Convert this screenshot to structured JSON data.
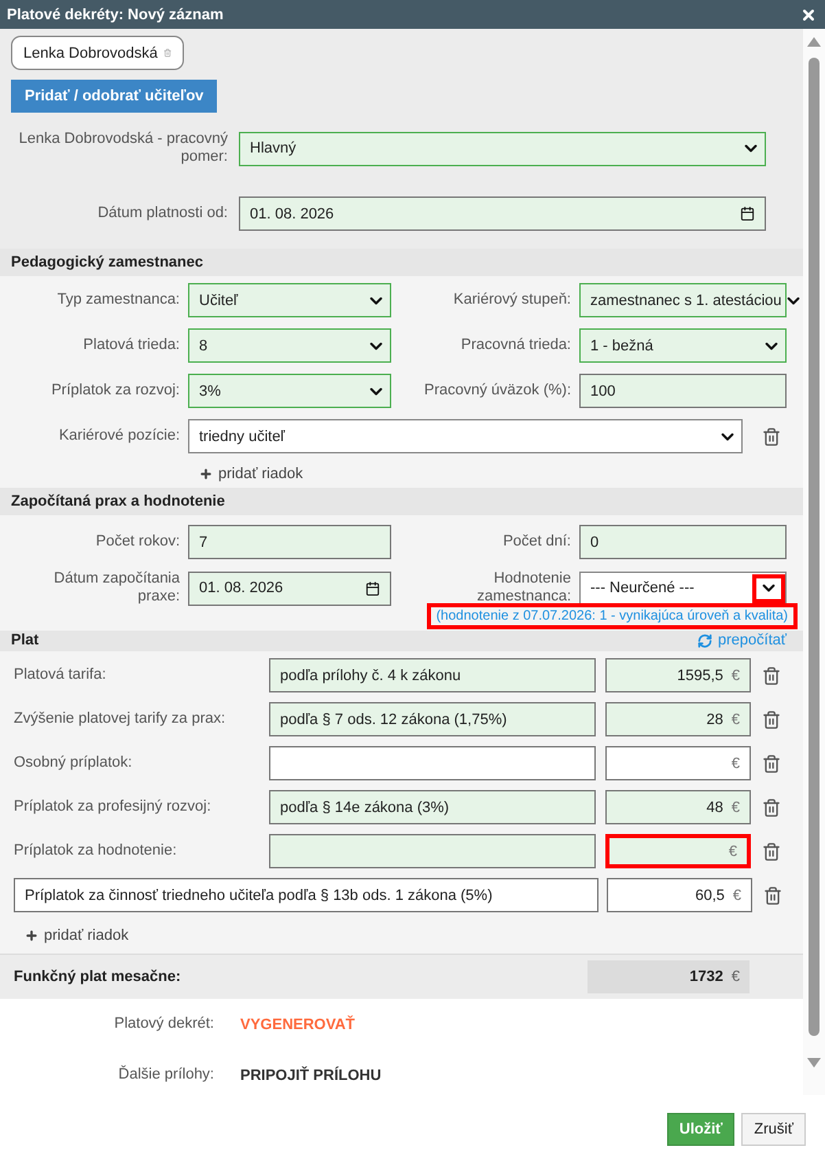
{
  "window": {
    "title": "Platové dekréty: Nový záznam"
  },
  "teachers": [
    {
      "name": "Lenka Dobrovodská"
    }
  ],
  "add_teachers_button": "Pridať / odobrať učiteľov",
  "general_fields": [
    {
      "label": "Lenka Dobrovodská - pracovný pomer:",
      "kind": "select",
      "value": "Hlavný",
      "prefilled": true
    },
    {
      "label": "Dátum platnosti od:",
      "kind": "date",
      "value": "01. 08. 2026",
      "prefilled": true
    }
  ],
  "pedagogical": {
    "title": "Pedagogický zamestnanec",
    "fields": [
      {
        "label": "Typ zamestnanca:",
        "kind": "select",
        "value": "Učiteľ",
        "prefilled": true
      },
      {
        "label": "Kariérový stupeň:",
        "kind": "select",
        "value": "zamestnanec s 1. atestáciou",
        "prefilled": true
      },
      {
        "label": "Platová trieda:",
        "kind": "select",
        "value": "8",
        "prefilled": true
      },
      {
        "label": "Pracovná trieda:",
        "kind": "select",
        "value": "1 - bežná",
        "prefilled": true
      },
      {
        "label": "Príplatok za rozvoj:",
        "kind": "select",
        "value": "3%",
        "prefilled": true
      },
      {
        "label": "Pracovný úväzok (%):",
        "kind": "text",
        "value": "100",
        "prefilled": true
      }
    ],
    "career_positions": [
      {
        "label": "Kariérové pozície:",
        "kind": "select",
        "value": "triedny učiteľ",
        "prefilled": false
      }
    ],
    "add_row": "pridať riadok"
  },
  "practice": {
    "title": "Započítaná prax a hodnotenie",
    "fields": [
      {
        "label": "Počet rokov:",
        "kind": "text",
        "value": "7",
        "prefilled": true
      },
      {
        "label": "Počet dní:",
        "kind": "text",
        "value": "0",
        "prefilled": true
      },
      {
        "label": "Dátum započítania praxe:",
        "kind": "date",
        "value": "01. 08. 2026",
        "prefilled": true
      },
      {
        "label": "Hodnotenie zamestnanca:",
        "kind": "select",
        "value": "--- Neurčené ---",
        "prefilled": false,
        "highlighted": true
      }
    ],
    "hint": {
      "text": "(hodnotenie z 07.07.2026: 1 - vynikajúca úroveň a kvalita)",
      "highlighted": true
    }
  },
  "salary": {
    "title": "Plat",
    "recalculate": "prepočítať",
    "items": [
      {
        "kind": "fixed",
        "label": "Platová tarifa:",
        "description": "podľa prílohy č. 4 k zákonu",
        "amount": "1595,5",
        "currency": "€",
        "prefilled": true,
        "highlighted": false
      },
      {
        "kind": "fixed",
        "label": "Zvýšenie platovej tarify za prax:",
        "description": "podľa § 7 ods. 12 zákona (1,75%)",
        "amount": "28",
        "currency": "€",
        "prefilled": true,
        "highlighted": false
      },
      {
        "kind": "fixed",
        "label": "Osobný príplatok:",
        "currency": "€",
        "prefilled": false,
        "highlighted": false
      },
      {
        "kind": "fixed",
        "label": "Príplatok za profesijný rozvoj:",
        "description": "podľa § 14e zákona (3%)",
        "amount": "48",
        "currency": "€",
        "prefilled": true,
        "highlighted": false
      },
      {
        "kind": "fixed",
        "label": "Príplatok za hodnotenie:",
        "currency": "€",
        "prefilled": true,
        "highlighted": true
      },
      {
        "kind": "custom",
        "description": "Príplatok za činnosť triedneho učiteľa podľa § 13b ods. 1 zákona (5%)",
        "amount": "60,5",
        "currency": "€",
        "prefilled": false,
        "highlighted": false
      }
    ],
    "add_row": "pridať riadok",
    "total": {
      "label": "Funkčný plat mesačne:",
      "amount": "1732",
      "currency": "€"
    }
  },
  "documents": [
    {
      "label": "Platový dekrét:",
      "action": "VYGENEROVAŤ",
      "kind": "generate"
    },
    {
      "label": "Ďalšie prílohy:",
      "action": "PRIPOJIŤ PRÍLOHU",
      "kind": "attach"
    }
  ],
  "buttons": [
    {
      "label": "Uložiť",
      "kind": "primary"
    },
    {
      "label": "Zrušiť",
      "kind": "secondary"
    }
  ]
}
